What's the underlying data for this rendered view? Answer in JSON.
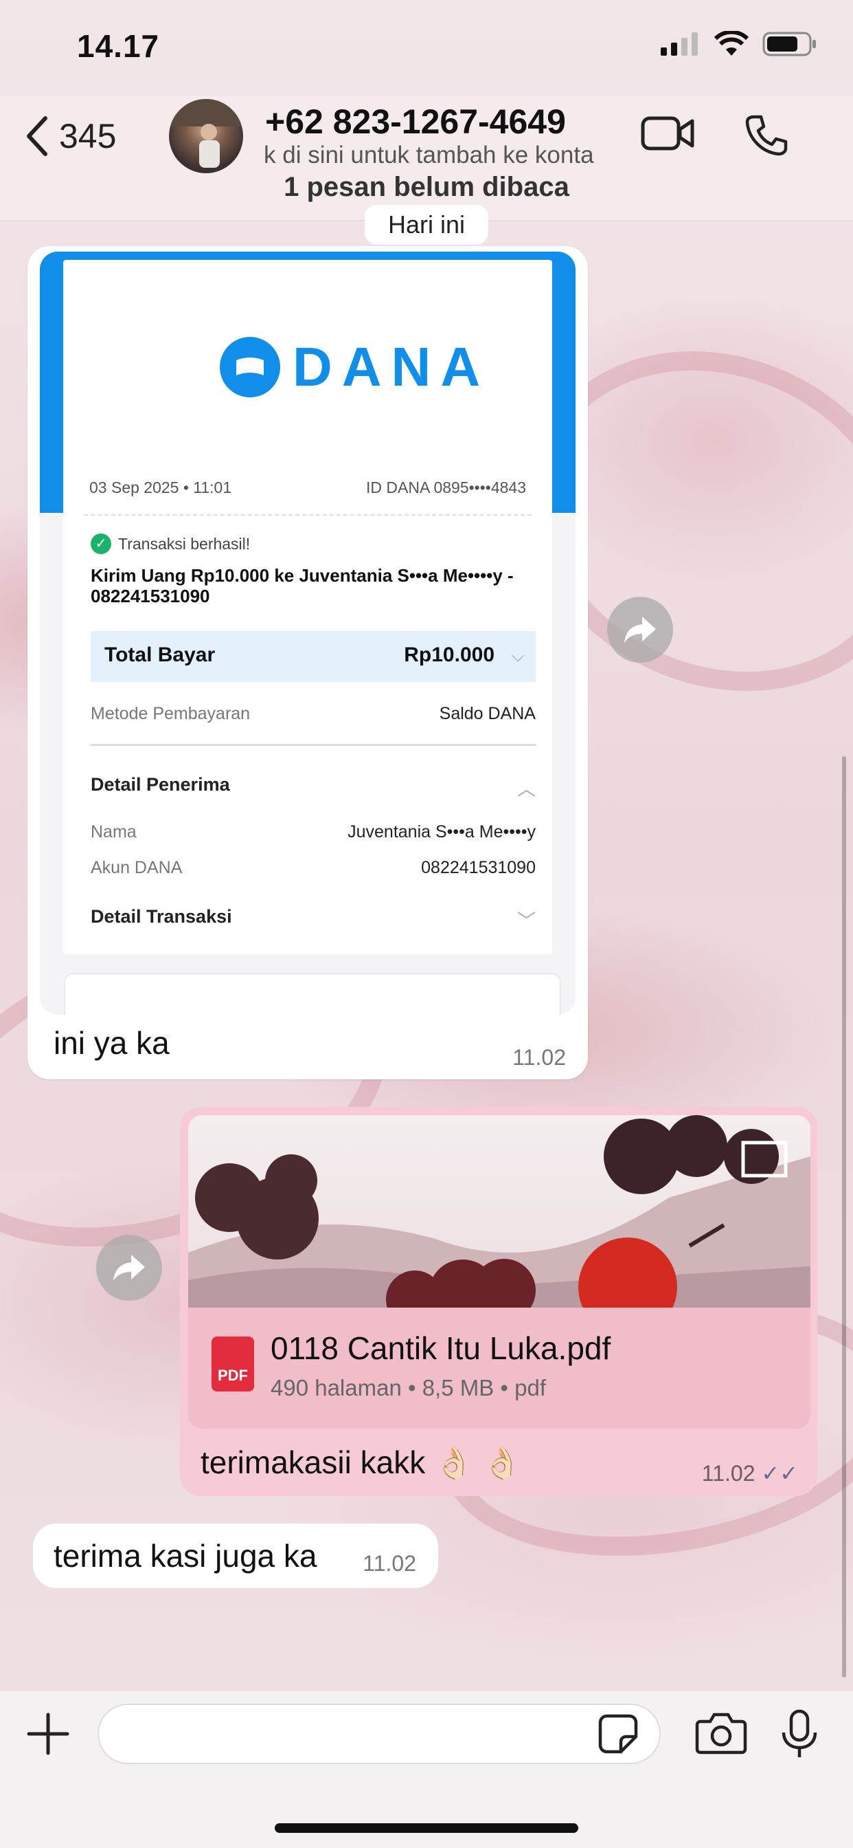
{
  "status_bar": {
    "time": "14.17"
  },
  "header": {
    "back_count": "345",
    "contact_name": "+62 823-1267-4649",
    "contact_subtitle": "k di sini untuk tambah ke konta",
    "unread_banner": "1 pesan belum dibaca"
  },
  "day_chip": "Hari ini",
  "messages": [
    {
      "direction": "in",
      "type": "image",
      "receipt": {
        "brand": "DANA",
        "date": "03 Sep 2025 • 11:01",
        "account_id": "ID DANA 0895••••4843",
        "status": "Transaksi berhasil!",
        "description": "Kirim Uang Rp10.000 ke Juventania S•••a Me••••y - 082241531090",
        "total_label": "Total Bayar",
        "total_value": "Rp10.000",
        "payment_method_label": "Metode Pembayaran",
        "payment_method_value": "Saldo DANA",
        "recipient_section": "Detail Penerima",
        "name_label": "Nama",
        "name_value": "Juventania S•••a Me••••y",
        "account_label": "Akun DANA",
        "account_value": "082241531090",
        "transaction_section": "Detail Transaksi"
      },
      "caption": "ini ya ka",
      "time": "11.02"
    },
    {
      "direction": "out",
      "type": "document",
      "doc_title": "0118 Cantik Itu Luka.pdf",
      "doc_meta": "490 halaman • 8,5 MB • pdf",
      "doc_icon_label": "PDF",
      "caption": "terimakasii kakk 👌🏻 👌🏻",
      "time": "11.02"
    },
    {
      "direction": "in",
      "type": "text",
      "text": "terima kasi juga ka",
      "time": "11.02"
    }
  ],
  "colors": {
    "outgoing_bubble": "#f6cbd5",
    "incoming_bubble": "#ffffff",
    "dana_blue": "#118ee9",
    "pdf_red": "#e22b3c"
  },
  "icons": [
    "back-chevron-icon",
    "video-call-icon",
    "phone-call-icon",
    "forward-icon",
    "pdf-icon",
    "plus-icon",
    "sticker-icon",
    "camera-icon",
    "microphone-icon"
  ]
}
